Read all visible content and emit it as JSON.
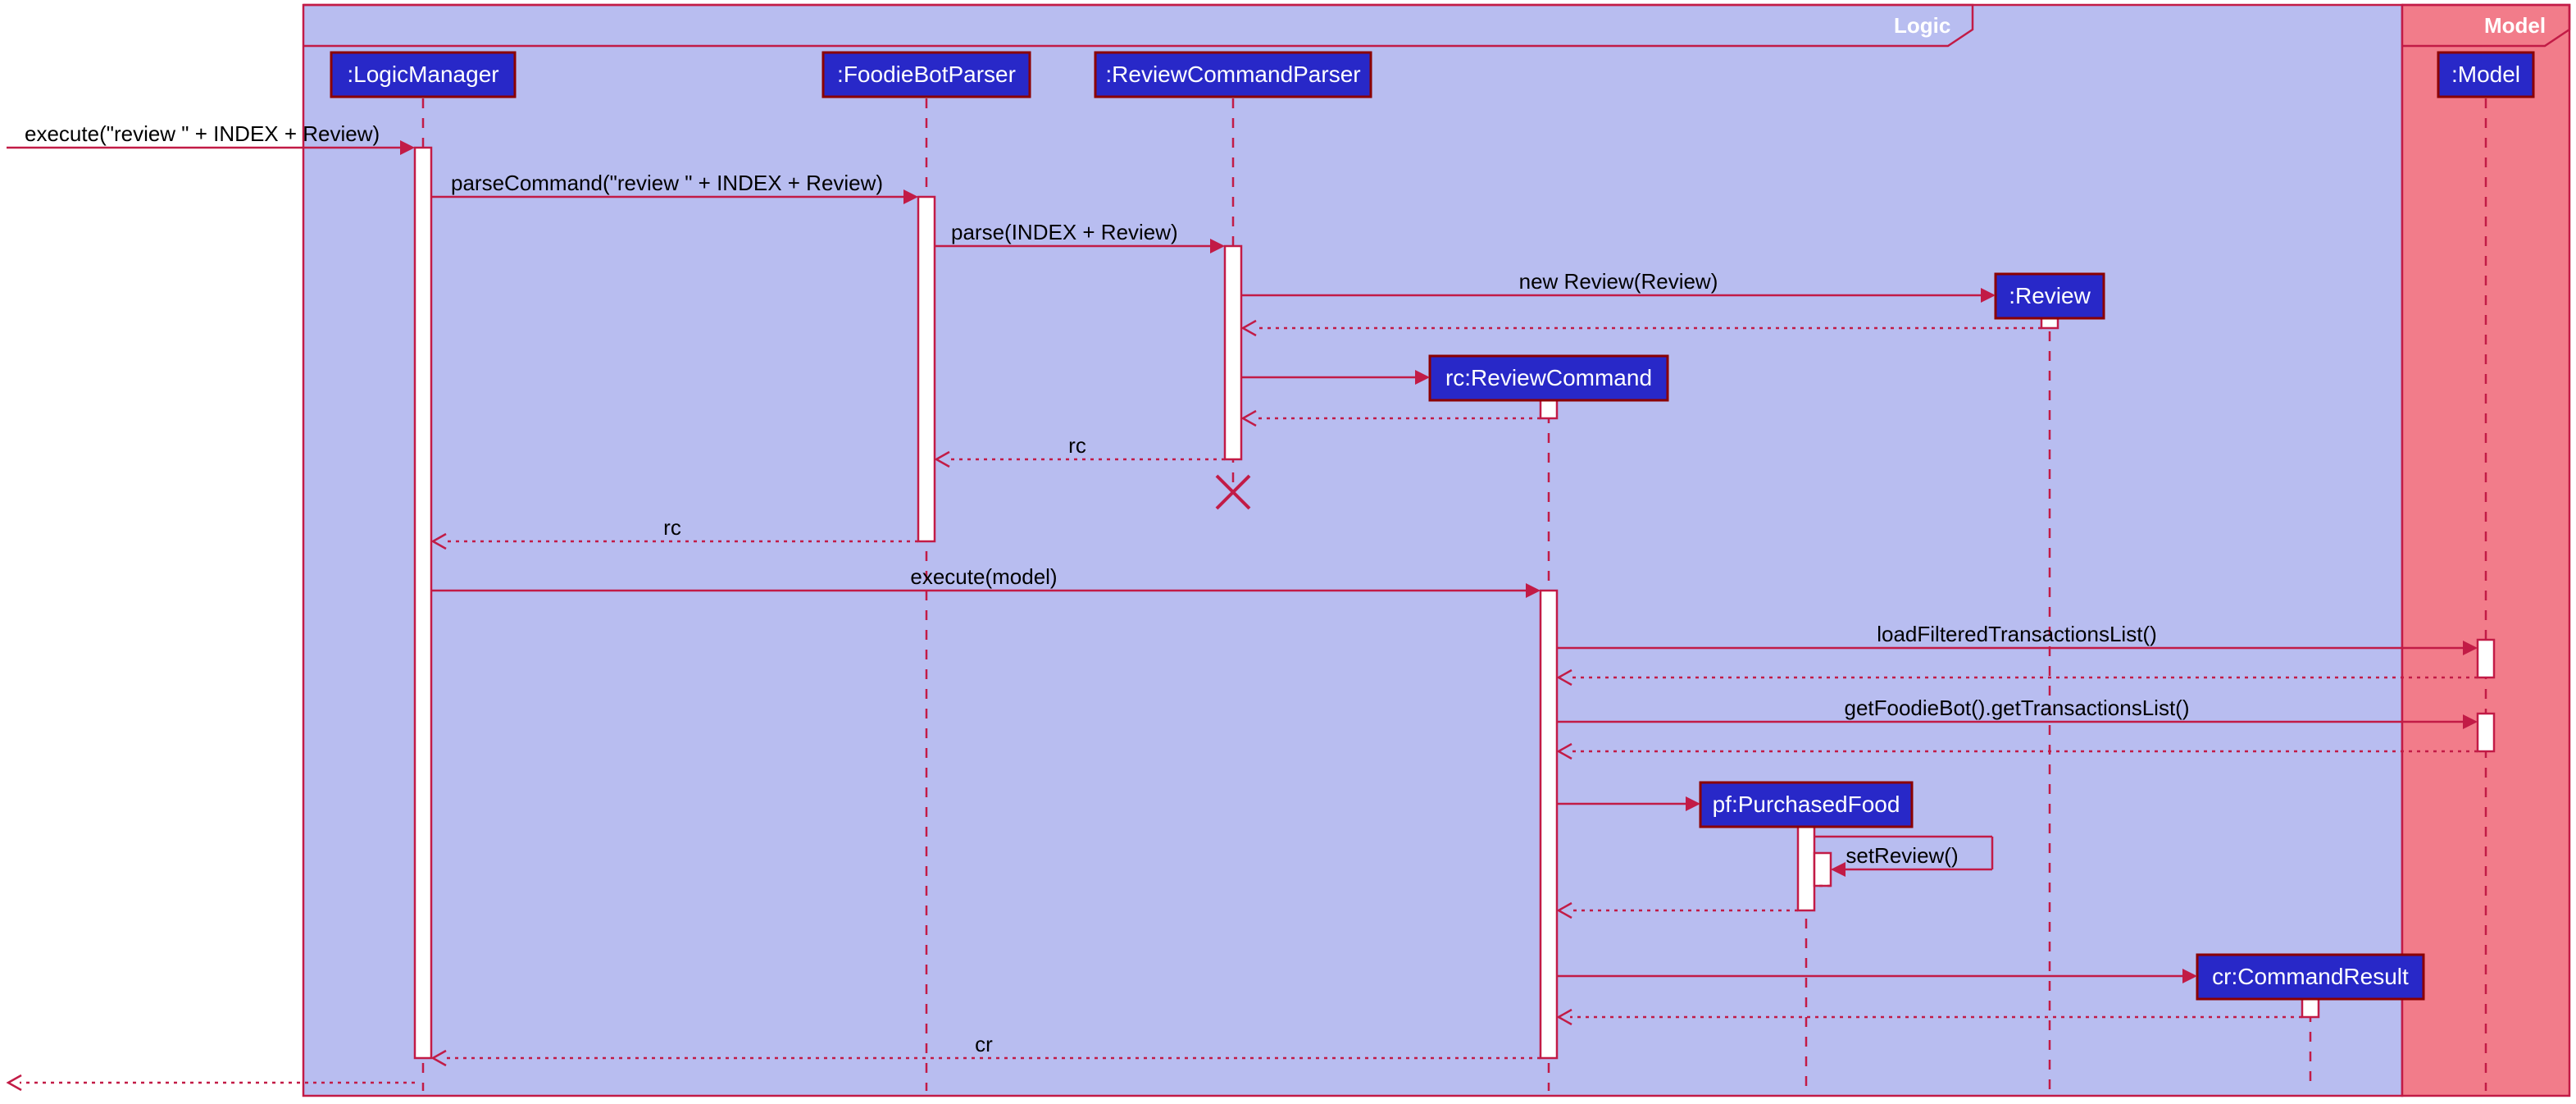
{
  "frames": {
    "logic": "Logic",
    "model": "Model"
  },
  "participants": {
    "logicManager": ":LogicManager",
    "foodieBotParser": ":FoodieBotParser",
    "reviewCommandParser": ":ReviewCommandParser",
    "review": ":Review",
    "reviewCommand": "rc:ReviewCommand",
    "purchasedFood": "pf:PurchasedFood",
    "commandResult": "cr:CommandResult",
    "model": ":Model"
  },
  "messages": {
    "m1": "execute(\"review \" + INDEX + Review)",
    "m2": "parseCommand(\"review \" + INDEX + Review)",
    "m3": "parse(INDEX + Review)",
    "m4": "new Review(Review)",
    "m5": "rc",
    "m6": "rc",
    "m7": "execute(model)",
    "m8": "loadFilteredTransactionsList()",
    "m9": "getFoodieBot().getTransactionsList()",
    "m10": "setReview()",
    "m11": "cr"
  }
}
